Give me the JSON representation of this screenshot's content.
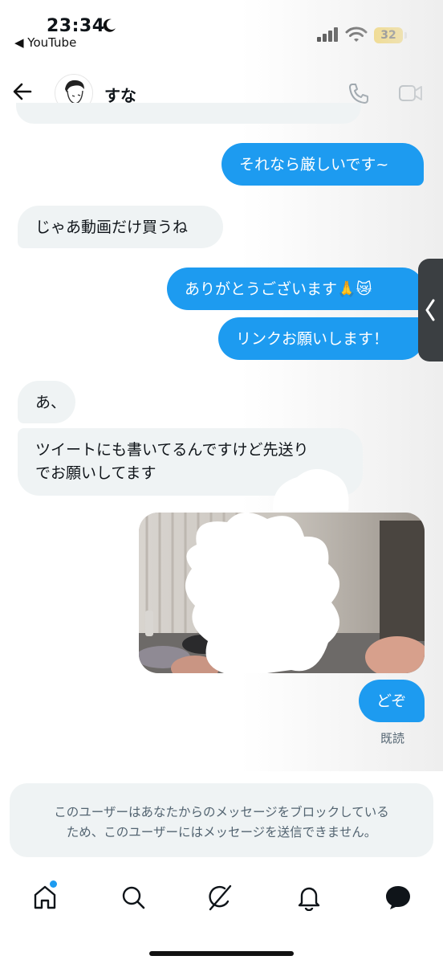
{
  "status_bar": {
    "time": "23:34",
    "back_app": "◀ YouTube",
    "battery": "32"
  },
  "header": {
    "name": "すな"
  },
  "messages": [
    {
      "dir": "out",
      "text": "それなら厳しいです~"
    },
    {
      "dir": "in",
      "text": "じゃあ動画だけ買うね"
    },
    {
      "dir": "out",
      "text": "ありがとうございます🙏😿"
    },
    {
      "dir": "out",
      "text": "リンクお願いします！"
    },
    {
      "dir": "in",
      "text": "あ、"
    },
    {
      "dir": "in",
      "text_lines": [
        "ツイートにも書いてるんですけど先送り",
        "でお願いしてます"
      ]
    },
    {
      "dir": "out",
      "type": "image"
    },
    {
      "dir": "out",
      "text": "どぞ"
    }
  ],
  "read_receipt": "既読",
  "block_notice": {
    "lines": [
      "このユーザーはあなたからのメッセージをブロックしている",
      "ため、このユーザーにはメッセージを送信できません。"
    ]
  },
  "nav": [
    "home-icon",
    "search-icon",
    "grok-icon",
    "notifications-icon",
    "messages-icon"
  ],
  "colors": {
    "accent": "#1d9bf0",
    "incoming_bubble": "#eff3f4",
    "battery": "#f5c518"
  }
}
